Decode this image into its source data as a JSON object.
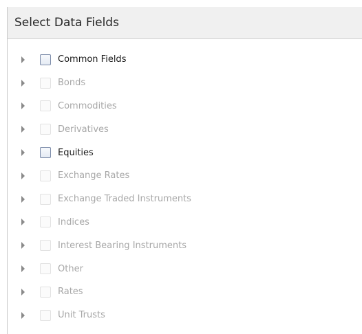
{
  "panel": {
    "title": "Select Data Fields"
  },
  "tree": {
    "items": [
      {
        "label": "Common Fields",
        "enabled": true,
        "checked": false
      },
      {
        "label": "Bonds",
        "enabled": false,
        "checked": false
      },
      {
        "label": "Commodities",
        "enabled": false,
        "checked": false
      },
      {
        "label": "Derivatives",
        "enabled": false,
        "checked": false
      },
      {
        "label": "Equities",
        "enabled": true,
        "checked": false
      },
      {
        "label": "Exchange Rates",
        "enabled": false,
        "checked": false
      },
      {
        "label": "Exchange Traded Instruments",
        "enabled": false,
        "checked": false
      },
      {
        "label": "Indices",
        "enabled": false,
        "checked": false
      },
      {
        "label": "Interest Bearing Instruments",
        "enabled": false,
        "checked": false
      },
      {
        "label": "Other",
        "enabled": false,
        "checked": false
      },
      {
        "label": "Rates",
        "enabled": false,
        "checked": false
      },
      {
        "label": "Unit Trusts",
        "enabled": false,
        "checked": false
      }
    ],
    "expander_icon": "triangle-right-icon"
  },
  "colors": {
    "enabled_text": "#1a1a1a",
    "disabled_text": "#a7a7a7",
    "expander": "#8a8a8a",
    "header_bg": "#f0f0f0"
  }
}
